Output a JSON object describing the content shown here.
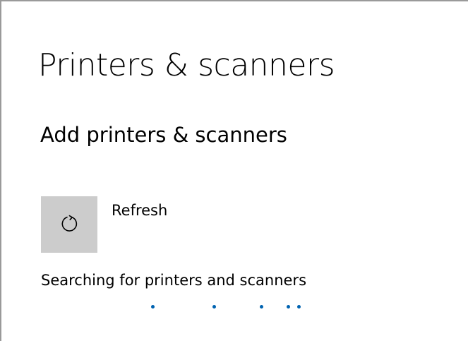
{
  "page": {
    "title": "Printers & scanners"
  },
  "section": {
    "title": "Add printers & scanners"
  },
  "refresh": {
    "label": "Refresh",
    "icon": "refresh-icon"
  },
  "status": {
    "text": "Searching for printers and scanners"
  },
  "colors": {
    "tile_background": "#cccccc",
    "accent": "#0063b1"
  }
}
